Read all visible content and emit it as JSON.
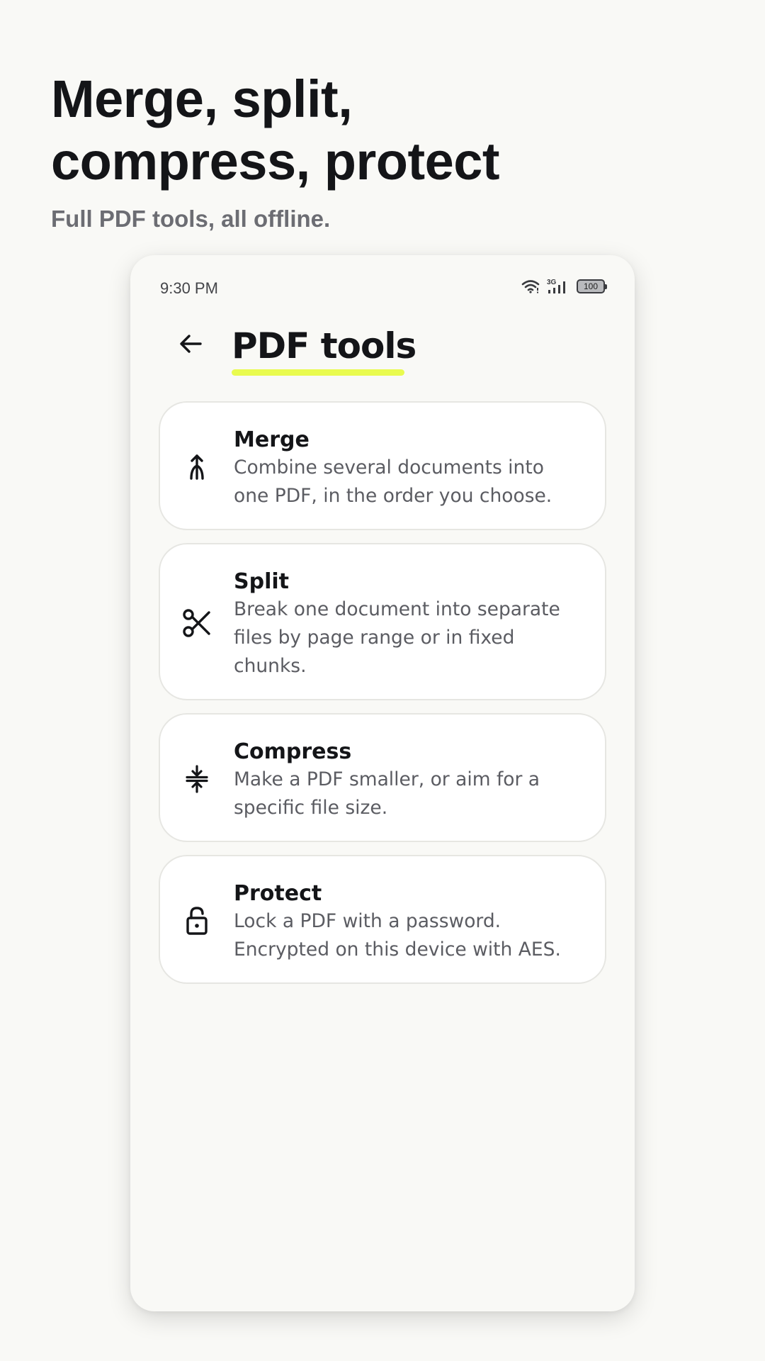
{
  "promo": {
    "headline_line1": "Merge, split,",
    "headline_line2": "compress, protect",
    "subtitle": "Full PDF tools, all offline.",
    "accent_color": "#e9fb4f"
  },
  "status_bar": {
    "time": "9:30 PM",
    "network": "3G",
    "battery": "100",
    "icons": [
      "wifi-icon",
      "cellular-signal-icon",
      "battery-icon"
    ]
  },
  "header": {
    "back_icon": "arrow-left-icon",
    "title": "PDF tools"
  },
  "tools": [
    {
      "name": "Merge",
      "description": "Combine several documents into one PDF, in the order you choose.",
      "icon": "merge-icon"
    },
    {
      "name": "Split",
      "description": "Break one document into separate files by page range or in fixed chunks.",
      "icon": "scissors-icon"
    },
    {
      "name": "Compress",
      "description": "Make a PDF smaller, or aim for a specific file size.",
      "icon": "compress-icon"
    },
    {
      "name": "Protect",
      "description": "Lock a PDF with a password. Encrypted on this device with AES.",
      "icon": "lock-icon"
    }
  ]
}
